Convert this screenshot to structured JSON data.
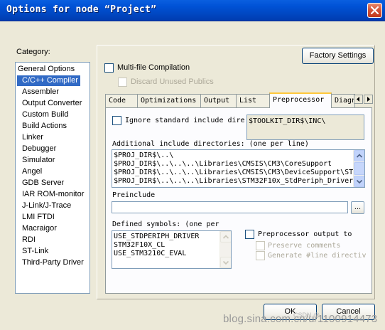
{
  "window": {
    "title": "Options for node “Project”"
  },
  "category": {
    "label": "Category:",
    "items": [
      {
        "label": "General Options",
        "indent": false,
        "selected": false
      },
      {
        "label": "C/C++ Compiler",
        "indent": true,
        "selected": true
      },
      {
        "label": "Assembler",
        "indent": true,
        "selected": false
      },
      {
        "label": "Output Converter",
        "indent": true,
        "selected": false
      },
      {
        "label": "Custom Build",
        "indent": true,
        "selected": false
      },
      {
        "label": "Build Actions",
        "indent": true,
        "selected": false
      },
      {
        "label": "Linker",
        "indent": true,
        "selected": false
      },
      {
        "label": "Debugger",
        "indent": true,
        "selected": false
      },
      {
        "label": "Simulator",
        "indent": true,
        "selected": false
      },
      {
        "label": "Angel",
        "indent": true,
        "selected": false
      },
      {
        "label": "GDB Server",
        "indent": true,
        "selected": false
      },
      {
        "label": "IAR ROM-monitor",
        "indent": true,
        "selected": false
      },
      {
        "label": "J-Link/J-Trace",
        "indent": true,
        "selected": false
      },
      {
        "label": "LMI FTDI",
        "indent": true,
        "selected": false
      },
      {
        "label": "Macraigor",
        "indent": true,
        "selected": false
      },
      {
        "label": "RDI",
        "indent": true,
        "selected": false
      },
      {
        "label": "ST-Link",
        "indent": true,
        "selected": false
      },
      {
        "label": "Third-Party Driver",
        "indent": true,
        "selected": false
      }
    ]
  },
  "panel": {
    "factory_settings": "Factory Settings",
    "multi_file": "Multi-file Compilation",
    "discard_unused": "Discard Unused Publics"
  },
  "tabs": [
    {
      "label": "Code",
      "active": false
    },
    {
      "label": "Optimizations",
      "active": false
    },
    {
      "label": "Output",
      "active": false
    },
    {
      "label": "List",
      "active": false
    },
    {
      "label": "Preprocessor",
      "active": true
    },
    {
      "label": "Diagn",
      "active": false
    }
  ],
  "preprocessor": {
    "ignore_std_label": "Ignore standard include dire",
    "ignore_std_value": "$TOOLKIT_DIR$\\INC\\",
    "additional_label": "Additional include directories: (one per line)",
    "include_dirs": [
      "$PROJ_DIR$\\..\\",
      "$PROJ_DIR$\\..\\..\\..\\Libraries\\CMSIS\\CM3\\CoreSupport",
      "$PROJ_DIR$\\..\\..\\..\\Libraries\\CMSIS\\CM3\\DeviceSupport\\ST",
      "$PROJ_DIR$\\..\\..\\..\\Libraries\\STM32F10x_StdPeriph_Driver"
    ],
    "preinclude_label": "Preinclude",
    "preinclude_value": "",
    "browse_label": "...",
    "defined_label": "Defined symbols: (one per",
    "symbols": [
      "USE_STDPERIPH_DRIVER",
      "STM32F10X_CL",
      "USE_STM3210C_EVAL"
    ],
    "pp_output_label": "Preprocessor output to",
    "preserve_comments": "Preserve comments",
    "generate_line": "Generate #line directiv"
  },
  "buttons": {
    "ok": "OK",
    "cancel": "Cancel"
  },
  "watermark": {
    "main": "blog.sina.com.cn/u/1100914473",
    "csdn": "CSDN @"
  }
}
